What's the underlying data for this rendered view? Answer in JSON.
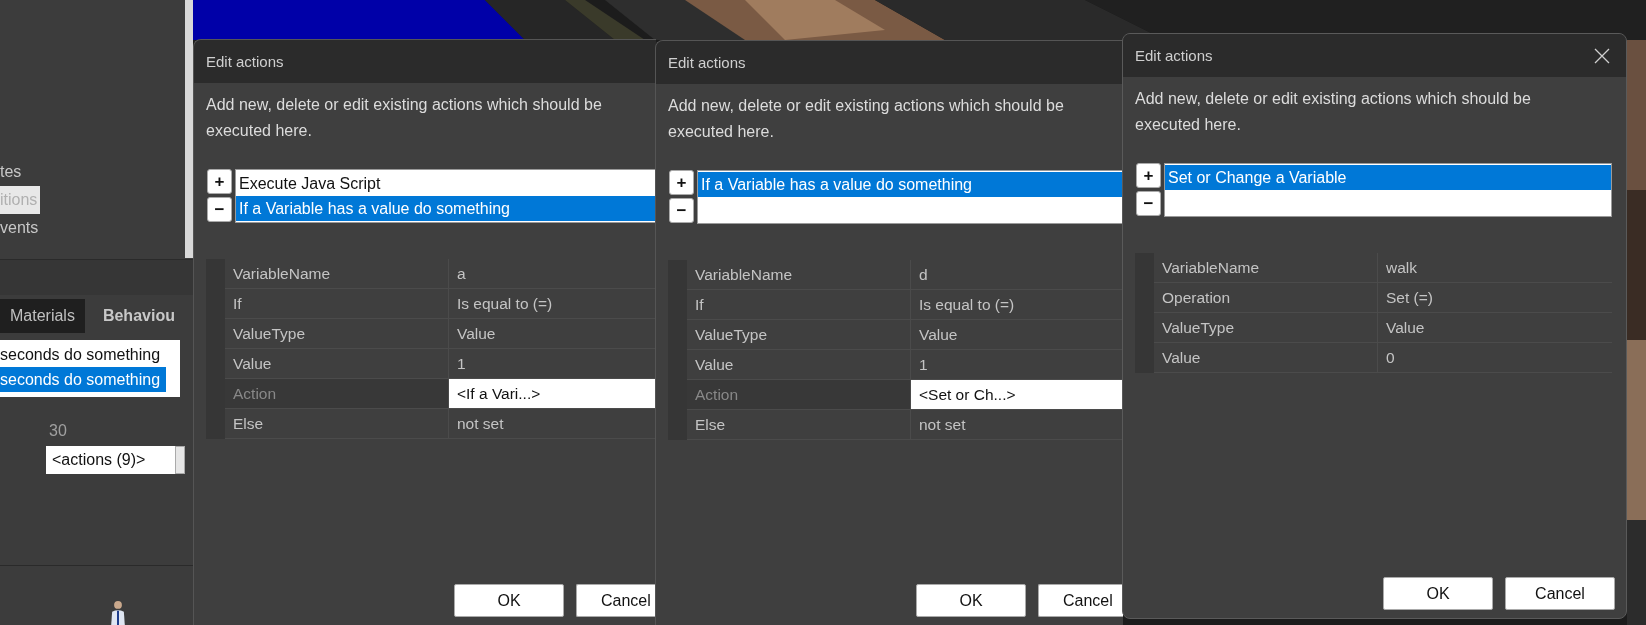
{
  "side_panel": {
    "items": [
      {
        "label": "tes",
        "selected": false
      },
      {
        "label": "itions",
        "selected": true
      },
      {
        "label": "vents",
        "selected": false
      }
    ],
    "tabs": [
      {
        "label": "Materials",
        "selected": false
      },
      {
        "label": "Behaviou",
        "selected": true
      }
    ],
    "list": [
      {
        "label": "seconds do something",
        "selected": false
      },
      {
        "label": "seconds do something",
        "selected": true
      }
    ],
    "properties": [
      {
        "value": "30",
        "kind": "text"
      },
      {
        "value": "<actions (9)>",
        "kind": "field"
      }
    ]
  },
  "dialogs": [
    {
      "title": "Edit actions",
      "close_button": false,
      "description": "Add new, delete or edit existing actions which should be executed here.",
      "add_button": "+",
      "remove_button": "−",
      "actions": [
        {
          "label": "Execute Java Script",
          "selected": false
        },
        {
          "label": "If a Variable has a value do something",
          "selected": true
        }
      ],
      "properties": [
        {
          "name": "VariableName",
          "value": "a",
          "kind": "text"
        },
        {
          "name": "If",
          "value": "Is equal to (=)",
          "kind": "text"
        },
        {
          "name": "ValueType",
          "value": "Value",
          "kind": "text"
        },
        {
          "name": "Value",
          "value": "1",
          "kind": "text"
        },
        {
          "name": "Action",
          "value": "<If a Vari...>",
          "kind": "field"
        },
        {
          "name": "Else",
          "value": "not set",
          "kind": "text"
        }
      ],
      "buttons": [
        "OK",
        "Cancel"
      ]
    },
    {
      "title": "Edit actions",
      "close_button": false,
      "description": "Add new, delete or edit existing actions which should be executed here.",
      "add_button": "+",
      "remove_button": "−",
      "actions": [
        {
          "label": "If a Variable has a value do something",
          "selected": true
        }
      ],
      "properties": [
        {
          "name": "VariableName",
          "value": "d",
          "kind": "text"
        },
        {
          "name": "If",
          "value": "Is equal to (=)",
          "kind": "text"
        },
        {
          "name": "ValueType",
          "value": "Value",
          "kind": "text"
        },
        {
          "name": "Value",
          "value": "1",
          "kind": "text"
        },
        {
          "name": "Action",
          "value": "<Set or Ch...>",
          "kind": "field"
        },
        {
          "name": "Else",
          "value": "not set",
          "kind": "text"
        }
      ],
      "buttons": [
        "OK",
        "Cancel"
      ]
    },
    {
      "title": "Edit actions",
      "close_button": true,
      "description": "Add new, delete or edit existing actions which should be executed here.",
      "add_button": "+",
      "remove_button": "−",
      "actions": [
        {
          "label": "Set or Change a Variable",
          "selected": true
        }
      ],
      "properties": [
        {
          "name": "VariableName",
          "value": "walk",
          "kind": "text"
        },
        {
          "name": "Operation",
          "value": "Set (=)",
          "kind": "text"
        },
        {
          "name": "ValueType",
          "value": "Value",
          "kind": "text"
        },
        {
          "name": "Value",
          "value": "0",
          "kind": "text"
        }
      ],
      "buttons": [
        "OK",
        "Cancel"
      ]
    }
  ]
}
